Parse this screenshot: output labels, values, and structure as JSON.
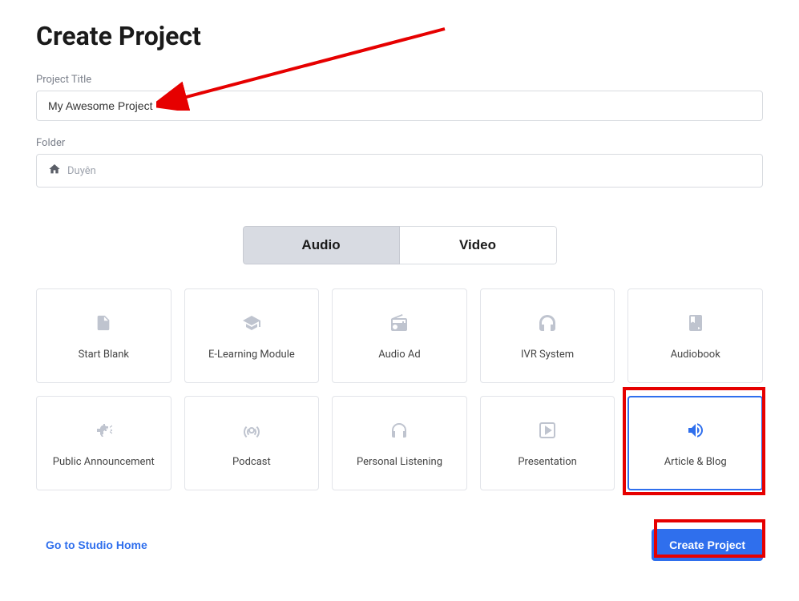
{
  "page_title": "Create Project",
  "fields": {
    "project_title": {
      "label": "Project Title",
      "value": "My Awesome Project"
    },
    "folder": {
      "label": "Folder",
      "value": "Duyên"
    }
  },
  "toggle": {
    "audio": "Audio",
    "video": "Video",
    "active": "audio"
  },
  "project_types": [
    {
      "id": "start-blank",
      "label": "Start Blank",
      "icon": "file"
    },
    {
      "id": "elearning",
      "label": "E-Learning Module",
      "icon": "graduation"
    },
    {
      "id": "audio-ad",
      "label": "Audio Ad",
      "icon": "radio"
    },
    {
      "id": "ivr",
      "label": "IVR System",
      "icon": "headset"
    },
    {
      "id": "audiobook",
      "label": "Audiobook",
      "icon": "book"
    },
    {
      "id": "public-announcement",
      "label": "Public Announcement",
      "icon": "megaphone"
    },
    {
      "id": "podcast",
      "label": "Podcast",
      "icon": "broadcast"
    },
    {
      "id": "personal-listening",
      "label": "Personal Listening",
      "icon": "headphones"
    },
    {
      "id": "presentation",
      "label": "Presentation",
      "icon": "play-square"
    },
    {
      "id": "article-blog",
      "label": "Article & Blog",
      "icon": "volume",
      "selected": true
    }
  ],
  "actions": {
    "studio_home": "Go to Studio Home",
    "create_project": "Create Project"
  },
  "colors": {
    "primary": "#2f6fed",
    "annotation_red": "#e60000"
  }
}
